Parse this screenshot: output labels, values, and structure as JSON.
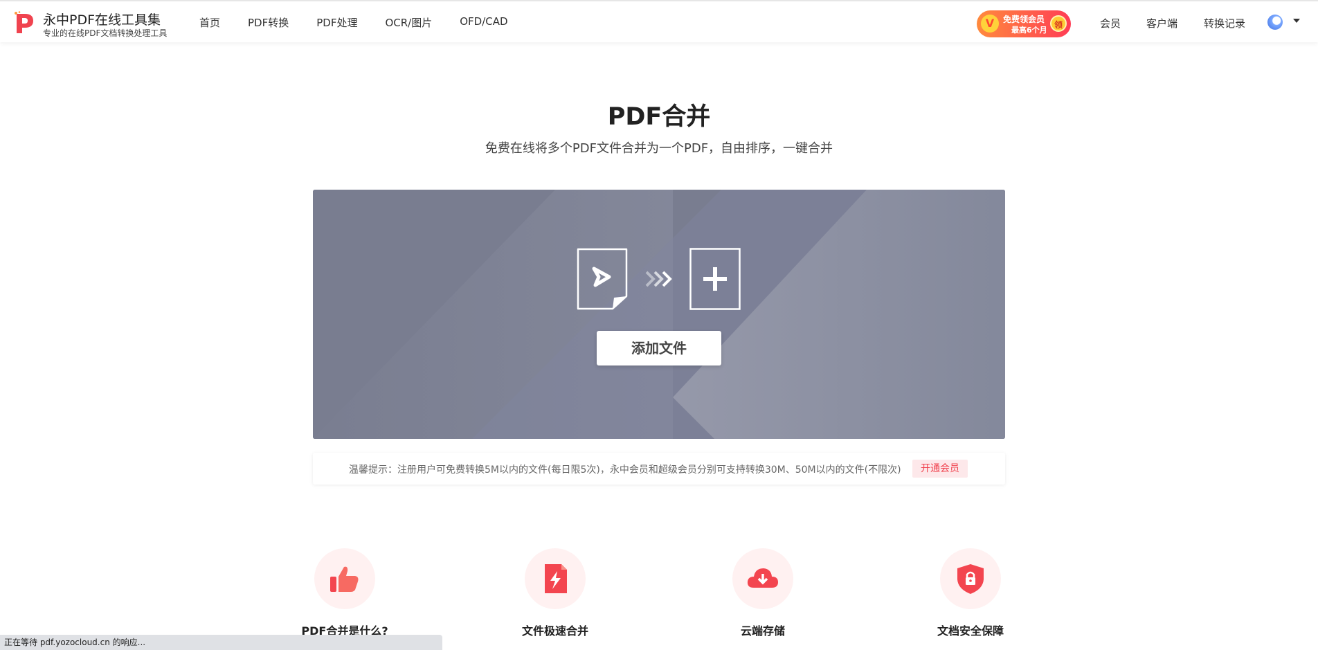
{
  "header": {
    "brand_title": "永中PDF在线工具集",
    "brand_subtitle": "专业的在线PDF文档转换处理工具",
    "nav": [
      "首页",
      "PDF转换",
      "PDF处理",
      "OCR/图片",
      "OFD/CAD"
    ],
    "promo": {
      "line1": "免费领会员",
      "line2": "最高6个月",
      "badge": "领"
    },
    "right_nav": [
      "会员",
      "客户端",
      "转换记录"
    ]
  },
  "hero": {
    "title": "PDF合并",
    "subtitle": "免费在线将多个PDF文件合并为一个PDF，自由排序，一键合并",
    "add_button": "添加文件"
  },
  "tip": {
    "text": "温馨提示：注册用户可免费转换5M以内的文件(每日限5次)，永中会员和超级会员分别可支持转换30M、50M以内的文件(不限次)",
    "button": "开通会员"
  },
  "features": [
    {
      "label": "PDF合并是什么?",
      "icon": "thumbs-up-icon"
    },
    {
      "label": "文件极速合并",
      "icon": "lightning-file-icon"
    },
    {
      "label": "云端存储",
      "icon": "cloud-download-icon"
    },
    {
      "label": "文档安全保障",
      "icon": "shield-lock-icon"
    }
  ],
  "status_bar": "正在等待 pdf.yozocloud.cn 的响应...",
  "colors": {
    "accent": "#f0434f",
    "drop_zone": "#7b7f92"
  }
}
